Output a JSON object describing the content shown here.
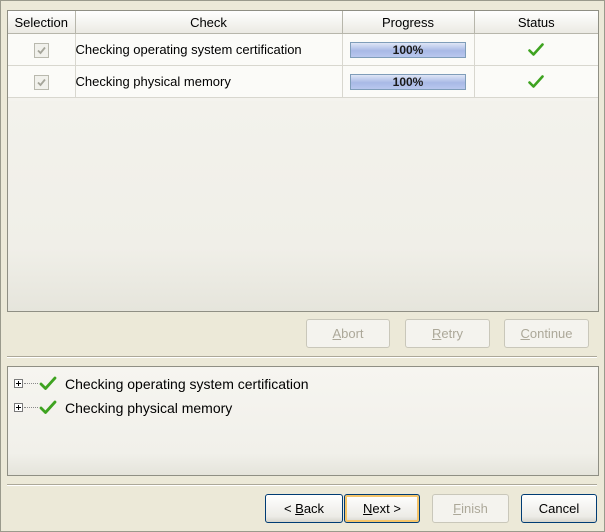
{
  "table": {
    "columns": [
      "Selection",
      "Check",
      "Progress",
      "Status"
    ],
    "rows": [
      {
        "check": "Checking operating system certification",
        "selected": true,
        "progress_text": "100%",
        "progress": 1.0,
        "status_icon": "check-icon"
      },
      {
        "check": "Checking physical memory",
        "selected": true,
        "progress_text": "100%",
        "progress": 1.0,
        "status_icon": "check-icon"
      }
    ]
  },
  "actions": {
    "abort": {
      "prefix": "",
      "mnemonic": "A",
      "suffix": "bort"
    },
    "retry": {
      "prefix": "",
      "mnemonic": "R",
      "suffix": "etry"
    },
    "continue": {
      "prefix": "",
      "mnemonic": "C",
      "suffix": "ontinue"
    }
  },
  "tree": {
    "items": [
      {
        "label": "Checking operating system certification",
        "icon": "check-icon"
      },
      {
        "label": "Checking physical memory",
        "icon": "check-icon"
      }
    ]
  },
  "nav": {
    "back": {
      "prefix": "< ",
      "mnemonic": "B",
      "suffix": "ack"
    },
    "next": {
      "prefix": "",
      "mnemonic": "N",
      "suffix": "ext >"
    },
    "finish": {
      "prefix": "",
      "mnemonic": "F",
      "suffix": "inish"
    },
    "cancel": {
      "label": "Cancel"
    }
  },
  "colors": {
    "check": "#3ea320",
    "progress_border": "#7f9db9",
    "button_border": "#003c74"
  }
}
